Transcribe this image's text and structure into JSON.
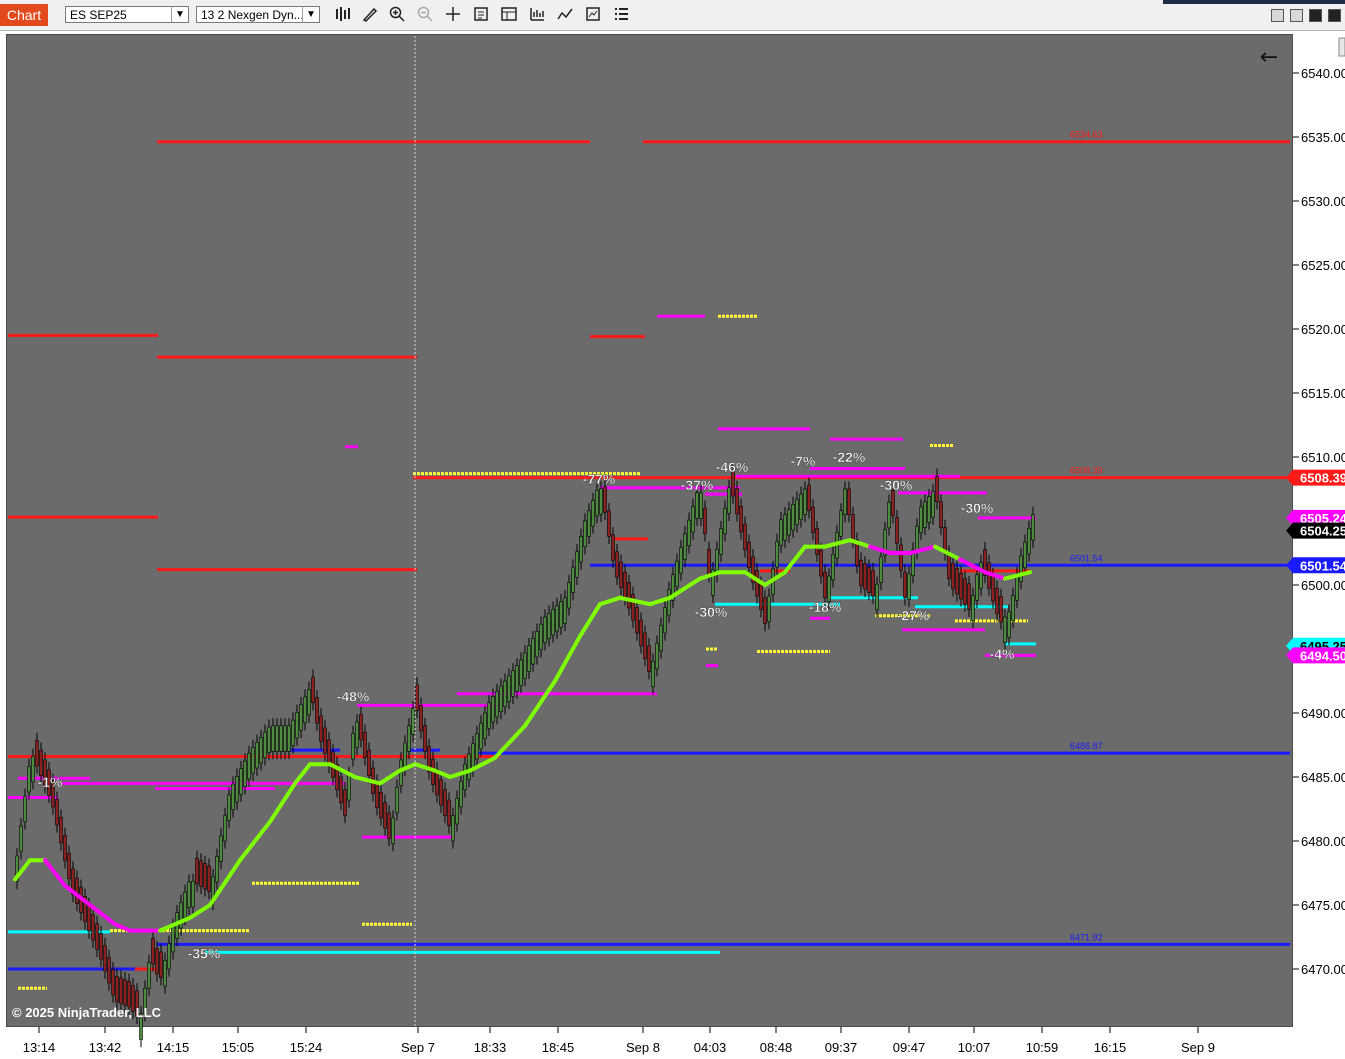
{
  "toolbar": {
    "chart_tab": "Chart",
    "instrument": "ES SEP25",
    "template": "13 2 Nexgen Dyn...",
    "icons": [
      "bars-icon",
      "draw-pencil-icon",
      "zoom-in-icon",
      "zoom-out-icon",
      "crosshair-icon",
      "data-box-icon",
      "properties-icon",
      "strategies-icon",
      "indicators-icon",
      "chart-trader-icon",
      "list-icon"
    ]
  },
  "chart": {
    "copyright": "© 2025 NinjaTrader, LLC",
    "back_arrow": "←",
    "background": "#6b6b6b",
    "colors": {
      "up_bar": "#4d8b3d",
      "down_bar": "#8a2020",
      "ma_up": "#7fff00",
      "ma_down": "#ff00ff",
      "red_level": "#ff1a1a",
      "blue_level": "#1a1aff",
      "cyan_level": "#00ffff",
      "magenta_level": "#ff00ff",
      "yellow_level": "#ffff33"
    }
  },
  "price_axis": {
    "ticks": [
      "6540.00",
      "6535.00",
      "6530.00",
      "6525.00",
      "6520.00",
      "6515.00",
      "6510.00",
      "6505.00",
      "6500.00",
      "6495.00",
      "6490.00",
      "6485.00",
      "6480.00",
      "6475.00",
      "6470.00"
    ],
    "markers": [
      {
        "label": "6508.39",
        "color": "#ff1a1a",
        "text_color": "#ffffff",
        "price": 6508.39
      },
      {
        "label": "6505.24",
        "color": "#ff00ff",
        "text_color": "#ffffff",
        "price": 6505.24
      },
      {
        "label": "6504.25",
        "color": "#000000",
        "text_color": "#ffffff",
        "price": 6504.25
      },
      {
        "label": "6501.54",
        "color": "#1a1aff",
        "text_color": "#ffffff",
        "price": 6501.54
      },
      {
        "label": "6495.25",
        "color": "#00ffff",
        "text_color": "#000000",
        "price": 6495.25
      },
      {
        "label": "6494.50",
        "color": "#ff00ff",
        "text_color": "#ffffff",
        "price": 6494.5
      }
    ]
  },
  "time_axis": {
    "labels": [
      "13:14",
      "13:42",
      "14:15",
      "15:05",
      "15:24",
      "Sep 7",
      "18:33",
      "18:45",
      "Sep 8",
      "04:03",
      "08:48",
      "09:37",
      "09:47",
      "10:07",
      "10:59",
      "16:15",
      "Sep 9"
    ]
  },
  "chart_data": {
    "type": "candlestick",
    "instrument": "ES SEP25",
    "ylim": [
      6466.5,
      6541.5
    ],
    "close_path": [
      [
        13,
        6476.5
      ],
      [
        31,
        6487
      ],
      [
        52,
        6483
      ],
      [
        72,
        6476
      ],
      [
        100,
        6471
      ],
      [
        115,
        6467.5
      ],
      [
        130,
        6467
      ],
      [
        140,
        6466
      ],
      [
        150,
        6471
      ],
      [
        160,
        6469
      ],
      [
        175,
        6474
      ],
      [
        190,
        6477
      ],
      [
        210,
        6476
      ],
      [
        230,
        6484
      ],
      [
        250,
        6487
      ],
      [
        270,
        6489
      ],
      [
        290,
        6489
      ],
      [
        310,
        6492
      ],
      [
        320,
        6488
      ],
      [
        335,
        6484.5
      ],
      [
        345,
        6482
      ],
      [
        355,
        6490
      ],
      [
        375,
        6483
      ],
      [
        390,
        6480
      ],
      [
        400,
        6486
      ],
      [
        415,
        6491
      ],
      [
        430,
        6485
      ],
      [
        450,
        6481
      ],
      [
        465,
        6486
      ],
      [
        490,
        6491
      ],
      [
        520,
        6494
      ],
      [
        545,
        6497.5
      ],
      [
        565,
        6499
      ],
      [
        585,
        6505
      ],
      [
        600,
        6508
      ],
      [
        615,
        6501
      ],
      [
        630,
        6498
      ],
      [
        650,
        6493
      ],
      [
        670,
        6500
      ],
      [
        700,
        6508
      ],
      [
        710,
        6500
      ],
      [
        730,
        6508
      ],
      [
        750,
        6501
      ],
      [
        765,
        6497
      ],
      [
        780,
        6505
      ],
      [
        805,
        6507.5
      ],
      [
        825,
        6499
      ],
      [
        845,
        6507.5
      ],
      [
        860,
        6500
      ],
      [
        875,
        6499
      ],
      [
        890,
        6507
      ],
      [
        905,
        6499
      ],
      [
        920,
        6506
      ],
      [
        935,
        6507.5
      ],
      [
        950,
        6500
      ],
      [
        970,
        6498
      ],
      [
        980,
        6502
      ],
      [
        1000,
        6497
      ],
      [
        1010,
        6498
      ],
      [
        1020,
        6502
      ],
      [
        1033,
        6505.5
      ]
    ],
    "moving_average": [
      [
        15,
        6477
      ],
      [
        30,
        6478.5
      ],
      [
        45,
        6478.5
      ],
      [
        65,
        6476.5
      ],
      [
        90,
        6475
      ],
      [
        115,
        6473.5
      ],
      [
        130,
        6473
      ],
      [
        160,
        6473
      ],
      [
        190,
        6474
      ],
      [
        210,
        6475
      ],
      [
        240,
        6478.5
      ],
      [
        270,
        6481.5
      ],
      [
        295,
        6484.5
      ],
      [
        310,
        6486
      ],
      [
        330,
        6486
      ],
      [
        355,
        6485
      ],
      [
        380,
        6484.5
      ],
      [
        400,
        6485.5
      ],
      [
        415,
        6486
      ],
      [
        435,
        6485.5
      ],
      [
        450,
        6485
      ],
      [
        470,
        6485.5
      ],
      [
        495,
        6486.5
      ],
      [
        525,
        6489
      ],
      [
        555,
        6492.5
      ],
      [
        580,
        6496
      ],
      [
        600,
        6498.5
      ],
      [
        620,
        6499
      ],
      [
        650,
        6498.5
      ],
      [
        670,
        6499
      ],
      [
        700,
        6500.5
      ],
      [
        720,
        6501
      ],
      [
        745,
        6501
      ],
      [
        765,
        6500
      ],
      [
        785,
        6501
      ],
      [
        805,
        6503
      ],
      [
        825,
        6503
      ],
      [
        850,
        6503.5
      ],
      [
        870,
        6503
      ],
      [
        890,
        6502.5
      ],
      [
        910,
        6502.5
      ],
      [
        935,
        6503
      ],
      [
        960,
        6502
      ],
      [
        985,
        6501
      ],
      [
        1005,
        6500.5
      ],
      [
        1030,
        6501
      ]
    ],
    "ma_color_segments": [
      {
        "from_x": 38,
        "to_x": 160,
        "color": "magenta"
      },
      {
        "from_x": 870,
        "to_x": 930,
        "color": "magenta"
      },
      {
        "from_x": 960,
        "to_x": 1005,
        "color": "magenta"
      }
    ],
    "level_lines": [
      {
        "color": "red",
        "price": 6534.63,
        "from_x": 157,
        "to_x": 590,
        "label": ""
      },
      {
        "color": "red",
        "price": 6534.63,
        "from_x": 643,
        "to_x": 1290,
        "label": "6534.63"
      },
      {
        "color": "red",
        "price": 6519.5,
        "from_x": 8,
        "to_x": 158,
        "label": ""
      },
      {
        "color": "red",
        "price": 6517.8,
        "from_x": 157,
        "to_x": 417,
        "label": ""
      },
      {
        "color": "red",
        "price": 6519.4,
        "from_x": 590,
        "to_x": 645,
        "label": ""
      },
      {
        "color": "red",
        "price": 6505.3,
        "from_x": 8,
        "to_x": 158,
        "label": ""
      },
      {
        "color": "red",
        "price": 6501.2,
        "from_x": 157,
        "to_x": 417,
        "label": ""
      },
      {
        "color": "red",
        "price": 6508.39,
        "from_x": 413,
        "to_x": 1290,
        "label": "6508.39"
      },
      {
        "color": "red",
        "price": 6486.6,
        "from_x": 8,
        "to_x": 500,
        "label": ""
      },
      {
        "color": "red",
        "price": 6470,
        "from_x": 130,
        "to_x": 158,
        "label": ""
      },
      {
        "color": "red",
        "price": 6503.6,
        "from_x": 612,
        "to_x": 648,
        "label": ""
      },
      {
        "color": "red",
        "price": 6501.1,
        "from_x": 760,
        "to_x": 790,
        "label": ""
      },
      {
        "color": "red",
        "price": 6501.1,
        "from_x": 960,
        "to_x": 1030,
        "label": ""
      },
      {
        "color": "blue",
        "price": 6501.54,
        "from_x": 590,
        "to_x": 1290,
        "label": "6501.54"
      },
      {
        "color": "blue",
        "price": 6486.87,
        "from_x": 477,
        "to_x": 1290,
        "label": "6486.87"
      },
      {
        "color": "blue",
        "price": 6471.92,
        "from_x": 157,
        "to_x": 1290,
        "label": "6471.92"
      },
      {
        "color": "blue",
        "price": 6470,
        "from_x": 8,
        "to_x": 135,
        "label": ""
      },
      {
        "color": "blue",
        "price": 6487.1,
        "from_x": 290,
        "to_x": 340,
        "label": ""
      },
      {
        "color": "blue",
        "price": 6487.1,
        "from_x": 408,
        "to_x": 440,
        "label": ""
      },
      {
        "color": "cyan",
        "price": 6472.9,
        "from_x": 8,
        "to_x": 110,
        "label": ""
      },
      {
        "color": "cyan",
        "price": 6471.3,
        "from_x": 205,
        "to_x": 720,
        "label": ""
      },
      {
        "color": "cyan",
        "price": 6498.5,
        "from_x": 715,
        "to_x": 840,
        "label": ""
      },
      {
        "color": "cyan",
        "price": 6499,
        "from_x": 828,
        "to_x": 918,
        "label": ""
      },
      {
        "color": "cyan",
        "price": 6498.3,
        "from_x": 915,
        "to_x": 1008,
        "label": ""
      },
      {
        "color": "cyan",
        "price": 6495.4,
        "from_x": 1005,
        "to_x": 1036,
        "label": ""
      },
      {
        "color": "magenta",
        "price": 6484.9,
        "from_x": 18,
        "to_x": 90,
        "label": ""
      },
      {
        "color": "magenta",
        "price": 6484.5,
        "from_x": 60,
        "to_x": 345,
        "label": ""
      },
      {
        "color": "magenta",
        "price": 6484.1,
        "from_x": 155,
        "to_x": 275,
        "label": ""
      },
      {
        "color": "magenta",
        "price": 6483.4,
        "from_x": 8,
        "to_x": 58,
        "label": ""
      },
      {
        "color": "magenta",
        "price": 6510.8,
        "from_x": 345,
        "to_x": 358,
        "label": ""
      },
      {
        "color": "magenta",
        "price": 6490.6,
        "from_x": 357,
        "to_x": 500,
        "label": ""
      },
      {
        "color": "magenta",
        "price": 6491.5,
        "from_x": 457,
        "to_x": 657,
        "label": ""
      },
      {
        "color": "magenta",
        "price": 6480.3,
        "from_x": 362,
        "to_x": 455,
        "label": ""
      },
      {
        "color": "magenta",
        "price": 6521,
        "from_x": 657,
        "to_x": 705,
        "label": ""
      },
      {
        "color": "magenta",
        "price": 6507.6,
        "from_x": 600,
        "to_x": 740,
        "label": ""
      },
      {
        "color": "magenta",
        "price": 6512.2,
        "from_x": 718,
        "to_x": 810,
        "label": ""
      },
      {
        "color": "magenta",
        "price": 6511.4,
        "from_x": 830,
        "to_x": 903,
        "label": ""
      },
      {
        "color": "magenta",
        "price": 6509.1,
        "from_x": 810,
        "to_x": 905,
        "label": ""
      },
      {
        "color": "magenta",
        "price": 6508.5,
        "from_x": 736,
        "to_x": 960,
        "label": ""
      },
      {
        "color": "magenta",
        "price": 6507.1,
        "from_x": 705,
        "to_x": 742,
        "label": ""
      },
      {
        "color": "magenta",
        "price": 6507.2,
        "from_x": 898,
        "to_x": 987,
        "label": ""
      },
      {
        "color": "magenta",
        "price": 6505.24,
        "from_x": 978,
        "to_x": 1036,
        "label": ""
      },
      {
        "color": "magenta",
        "price": 6497.4,
        "from_x": 810,
        "to_x": 830,
        "label": ""
      },
      {
        "color": "magenta",
        "price": 6496.5,
        "from_x": 902,
        "to_x": 985,
        "label": ""
      },
      {
        "color": "magenta",
        "price": 6493.7,
        "from_x": 706,
        "to_x": 718,
        "label": ""
      },
      {
        "color": "magenta",
        "price": 6494.5,
        "from_x": 985,
        "to_x": 1036,
        "label": ""
      },
      {
        "color": "yellow",
        "price": 6468.5,
        "from_x": 18,
        "to_x": 47,
        "label": ""
      },
      {
        "color": "yellow",
        "price": 6473,
        "from_x": 110,
        "to_x": 250,
        "label": ""
      },
      {
        "color": "yellow",
        "price": 6476.7,
        "from_x": 252,
        "to_x": 360,
        "label": ""
      },
      {
        "color": "yellow",
        "price": 6473.5,
        "from_x": 362,
        "to_x": 412,
        "label": ""
      },
      {
        "color": "yellow",
        "price": 6508.7,
        "from_x": 413,
        "to_x": 640,
        "label": ""
      },
      {
        "color": "yellow",
        "price": 6521,
        "from_x": 718,
        "to_x": 757,
        "label": ""
      },
      {
        "color": "yellow",
        "price": 6510.9,
        "from_x": 930,
        "to_x": 953,
        "label": ""
      },
      {
        "color": "yellow",
        "price": 6495,
        "from_x": 706,
        "to_x": 718,
        "label": ""
      },
      {
        "color": "yellow",
        "price": 6494.8,
        "from_x": 757,
        "to_x": 830,
        "label": ""
      },
      {
        "color": "yellow",
        "price": 6497.6,
        "from_x": 875,
        "to_x": 930,
        "label": ""
      },
      {
        "color": "yellow",
        "price": 6497.2,
        "from_x": 955,
        "to_x": 1028,
        "label": ""
      }
    ],
    "annotations": [
      {
        "text": "-1%",
        "x": 50,
        "price": 6484.6
      },
      {
        "text": "-35%",
        "x": 204,
        "price": 6471.2
      },
      {
        "text": "-48%",
        "x": 353,
        "price": 6491.3
      },
      {
        "text": "-77%",
        "x": 599,
        "price": 6508.3
      },
      {
        "text": "-37%",
        "x": 697,
        "price": 6507.8
      },
      {
        "text": "-46%",
        "x": 732,
        "price": 6509.2
      },
      {
        "text": "-7%",
        "x": 803,
        "price": 6509.7
      },
      {
        "text": "-22%",
        "x": 849,
        "price": 6510
      },
      {
        "text": "-30%",
        "x": 896,
        "price": 6507.8
      },
      {
        "text": "-30%",
        "x": 977,
        "price": 6506
      },
      {
        "text": "-30%",
        "x": 711,
        "price": 6497.9
      },
      {
        "text": "-18%",
        "x": 825,
        "price": 6498.3
      },
      {
        "text": "-27%",
        "x": 913,
        "price": 6497.6
      },
      {
        "text": "-4%",
        "x": 1002,
        "price": 6494.6
      }
    ]
  }
}
